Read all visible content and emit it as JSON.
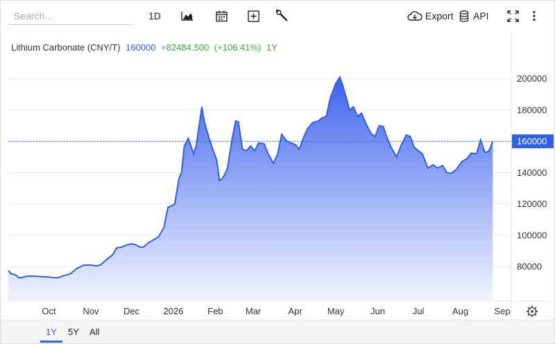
{
  "toolbar": {
    "search_placeholder": "Search...",
    "interval_label": "1D",
    "export_label": "Export",
    "api_label": "API"
  },
  "legend": {
    "name": "Lithium Carbonate (CNY/T)",
    "price": "160000",
    "change": "+82484.500",
    "percent": "(+106.41%)",
    "period": "1Y"
  },
  "range_buttons": [
    "1Y",
    "5Y",
    "All"
  ],
  "colors": {
    "line": "#2f5fe8",
    "fill_top": "#3d63ee",
    "fill_bottom": "#eef1fd",
    "up_text": "#3fa33f",
    "price_text": "#2f5fe8"
  },
  "icons": [
    "area-chart-icon",
    "calendar-icon",
    "add-indicator-icon",
    "wrench-icon",
    "cloud-download-icon",
    "database-icon",
    "fullscreen-icon",
    "more-vertical-icon",
    "settings-gear-icon"
  ],
  "chart_data": {
    "type": "area",
    "title": "Lithium Carbonate (CNY/T)",
    "xlabel": "",
    "ylabel": "",
    "ylim": [
      58000,
      214000
    ],
    "yticks": [
      80000,
      100000,
      120000,
      140000,
      160000,
      180000,
      200000
    ],
    "ytick_labels": [
      "80000",
      "100000",
      "120000",
      "140000",
      "160000",
      "180000",
      "200000"
    ],
    "xticks": [
      {
        "label": "Oct",
        "x": "2025-10-01"
      },
      {
        "label": "Nov",
        "x": "2025-11-01"
      },
      {
        "label": "Dec",
        "x": "2025-12-01"
      },
      {
        "label": "2026",
        "x": "2026-01-01"
      },
      {
        "label": "Feb",
        "x": "2026-02-01"
      },
      {
        "label": "Mar",
        "x": "2026-03-01"
      },
      {
        "label": "Apr",
        "x": "2026-04-01"
      },
      {
        "label": "May",
        "x": "2026-05-01"
      },
      {
        "label": "Jun",
        "x": "2026-06-01"
      },
      {
        "label": "Jul",
        "x": "2026-07-01"
      },
      {
        "label": "Aug",
        "x": "2026-08-01"
      },
      {
        "label": "Sep",
        "x": "2026-09-01"
      }
    ],
    "last_value": 160000,
    "last_value_label": "160000",
    "grid": true,
    "series": [
      {
        "values": [
          [
            "2025-09-01",
            77500
          ],
          [
            "2025-09-03",
            75500
          ],
          [
            "2025-09-05",
            75000
          ],
          [
            "2025-09-07",
            74500
          ],
          [
            "2025-09-08",
            73200
          ],
          [
            "2025-09-10",
            72800
          ],
          [
            "2025-09-13",
            73500
          ],
          [
            "2025-09-17",
            74000
          ],
          [
            "2025-09-22",
            73800
          ],
          [
            "2025-09-27",
            73500
          ],
          [
            "2025-10-02",
            73300
          ],
          [
            "2025-10-04",
            72900
          ],
          [
            "2025-10-08",
            73000
          ],
          [
            "2025-10-12",
            74200
          ],
          [
            "2025-10-17",
            75500
          ],
          [
            "2025-10-22",
            79000
          ],
          [
            "2025-10-27",
            81000
          ],
          [
            "2025-11-01",
            81000
          ],
          [
            "2025-11-05",
            80500
          ],
          [
            "2025-11-08",
            81000
          ],
          [
            "2025-11-12",
            84000
          ],
          [
            "2025-11-17",
            87500
          ],
          [
            "2025-11-20",
            92000
          ],
          [
            "2025-11-24",
            92500
          ],
          [
            "2025-11-28",
            94000
          ],
          [
            "2025-12-01",
            94500
          ],
          [
            "2025-12-04",
            94000
          ],
          [
            "2025-12-07",
            92500
          ],
          [
            "2025-12-10",
            92500
          ],
          [
            "2025-12-13",
            95000
          ],
          [
            "2025-12-17",
            97000
          ],
          [
            "2025-12-21",
            99000
          ],
          [
            "2025-12-25",
            105000
          ],
          [
            "2025-12-28",
            118000
          ],
          [
            "2025-12-30",
            118500
          ],
          [
            "2026-01-02",
            120000
          ],
          [
            "2026-01-05",
            136000
          ],
          [
            "2026-01-07",
            140000
          ],
          [
            "2026-01-09",
            157000
          ],
          [
            "2026-01-12",
            162000
          ],
          [
            "2026-01-14",
            157000
          ],
          [
            "2026-01-16",
            152000
          ],
          [
            "2026-01-18",
            158000
          ],
          [
            "2026-01-20",
            170000
          ],
          [
            "2026-01-22",
            182000
          ],
          [
            "2026-01-24",
            172000
          ],
          [
            "2026-01-27",
            163000
          ],
          [
            "2026-01-30",
            155000
          ],
          [
            "2026-02-02",
            148000
          ],
          [
            "2026-02-04",
            135000
          ],
          [
            "2026-02-06",
            136000
          ],
          [
            "2026-02-08",
            139000
          ],
          [
            "2026-02-10",
            143000
          ],
          [
            "2026-02-13",
            160000
          ],
          [
            "2026-02-16",
            173000
          ],
          [
            "2026-02-18",
            172500
          ],
          [
            "2026-02-21",
            155000
          ],
          [
            "2026-02-24",
            154000
          ],
          [
            "2026-02-27",
            157000
          ],
          [
            "2026-03-02",
            154000
          ],
          [
            "2026-03-05",
            159000
          ],
          [
            "2026-03-09",
            158500
          ],
          [
            "2026-03-12",
            152000
          ],
          [
            "2026-03-16",
            146000
          ],
          [
            "2026-03-19",
            152000
          ],
          [
            "2026-03-22",
            164500
          ],
          [
            "2026-03-26",
            160000
          ],
          [
            "2026-03-29",
            159000
          ],
          [
            "2026-04-01",
            158000
          ],
          [
            "2026-04-04",
            155000
          ],
          [
            "2026-04-07",
            162000
          ],
          [
            "2026-04-10",
            168000
          ],
          [
            "2026-04-14",
            172000
          ],
          [
            "2026-04-18",
            173000
          ],
          [
            "2026-04-21",
            175000
          ],
          [
            "2026-04-24",
            176000
          ],
          [
            "2026-04-27",
            188000
          ],
          [
            "2026-05-01",
            197000
          ],
          [
            "2026-05-04",
            201000
          ],
          [
            "2026-05-06",
            196000
          ],
          [
            "2026-05-09",
            187000
          ],
          [
            "2026-05-11",
            180000
          ],
          [
            "2026-05-14",
            182000
          ],
          [
            "2026-05-17",
            176000
          ],
          [
            "2026-05-20",
            178000
          ],
          [
            "2026-05-24",
            170000
          ],
          [
            "2026-05-27",
            165000
          ],
          [
            "2026-05-30",
            163000
          ],
          [
            "2026-06-02",
            170000
          ],
          [
            "2026-06-05",
            169500
          ],
          [
            "2026-06-08",
            162000
          ],
          [
            "2026-06-11",
            156000
          ],
          [
            "2026-06-15",
            150000
          ],
          [
            "2026-06-18",
            157000
          ],
          [
            "2026-06-22",
            164000
          ],
          [
            "2026-06-25",
            163000
          ],
          [
            "2026-06-28",
            156000
          ],
          [
            "2026-07-01",
            154000
          ],
          [
            "2026-07-04",
            152000
          ],
          [
            "2026-07-08",
            143000
          ],
          [
            "2026-07-12",
            145000
          ],
          [
            "2026-07-15",
            143000
          ],
          [
            "2026-07-19",
            144500
          ],
          [
            "2026-07-22",
            140000
          ],
          [
            "2026-07-25",
            139500
          ],
          [
            "2026-07-29",
            142000
          ],
          [
            "2026-08-02",
            147000
          ],
          [
            "2026-08-06",
            149000
          ],
          [
            "2026-08-09",
            152500
          ],
          [
            "2026-08-13",
            152000
          ],
          [
            "2026-08-16",
            161000
          ],
          [
            "2026-08-19",
            153000
          ],
          [
            "2026-08-22",
            153500
          ],
          [
            "2026-08-25",
            160000
          ]
        ]
      }
    ]
  }
}
